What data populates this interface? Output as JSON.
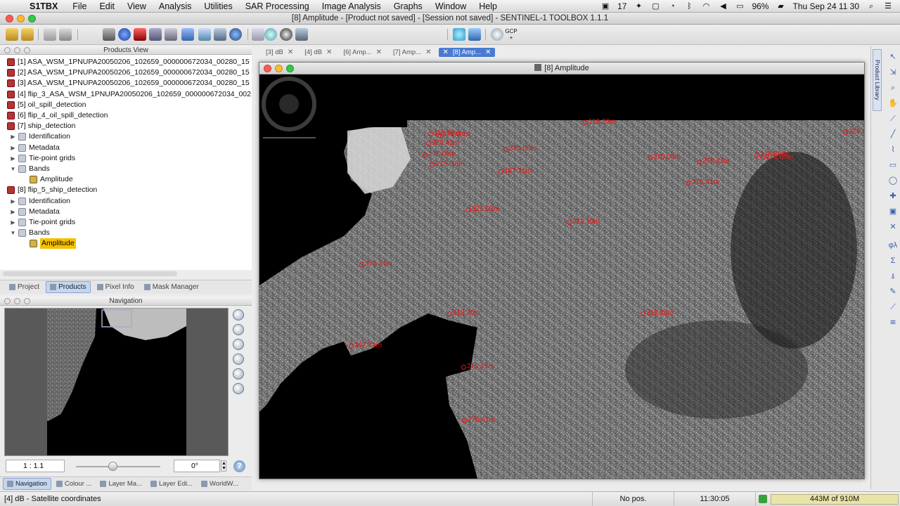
{
  "menubar": {
    "app": "S1TBX",
    "items": [
      "File",
      "Edit",
      "View",
      "Analysis",
      "Utilities",
      "SAR Processing",
      "Image Analysis",
      "Graphs",
      "Window",
      "Help"
    ],
    "status": {
      "cal": "17",
      "battery": "96%",
      "clock": "Thu Sep 24  11 30"
    }
  },
  "window": {
    "title": "[8] Amplitude - [Product not saved] - [Session not saved] - SENTINEL-1 TOOLBOX 1.1.1"
  },
  "products_view": {
    "title": "Products View",
    "items": [
      {
        "label": "[1] ASA_WSM_1PNUPA20050206_102659_000000672034_00280_15",
        "type": "prod",
        "indent": 0
      },
      {
        "label": "[2] ASA_WSM_1PNUPA20050206_102659_000000672034_00280_15",
        "type": "prod",
        "indent": 0
      },
      {
        "label": "[3] ASA_WSM_1PNUPA20050206_102659_000000672034_00280_15",
        "type": "prod",
        "indent": 0
      },
      {
        "label": "[4] flip_3_ASA_WSM_1PNUPA20050206_102659_000000672034_002",
        "type": "prod",
        "indent": 0
      },
      {
        "label": "[5] oil_spill_detection",
        "type": "prod",
        "indent": 0
      },
      {
        "label": "[6] flip_4_oil_spill_detection",
        "type": "prod",
        "indent": 0
      },
      {
        "label": "[7] ship_detection",
        "type": "prod",
        "indent": 0
      },
      {
        "label": "Identification",
        "type": "fold",
        "indent": 1,
        "arrow": "▶"
      },
      {
        "label": "Metadata",
        "type": "fold",
        "indent": 1,
        "arrow": "▶"
      },
      {
        "label": "Tie-point grids",
        "type": "fold",
        "indent": 1,
        "arrow": "▶"
      },
      {
        "label": "Bands",
        "type": "fold",
        "indent": 1,
        "arrow": "▼"
      },
      {
        "label": "Amplitude",
        "type": "band",
        "indent": 2
      },
      {
        "label": "[8] flip_5_ship_detection",
        "type": "prod",
        "indent": 0
      },
      {
        "label": "Identification",
        "type": "fold",
        "indent": 1,
        "arrow": "▶"
      },
      {
        "label": "Metadata",
        "type": "fold",
        "indent": 1,
        "arrow": "▶"
      },
      {
        "label": "Tie-point grids",
        "type": "fold",
        "indent": 1,
        "arrow": "▶"
      },
      {
        "label": "Bands",
        "type": "fold",
        "indent": 1,
        "arrow": "▼"
      },
      {
        "label": "Amplitude",
        "type": "band",
        "indent": 2,
        "selected": true
      }
    ]
  },
  "left_tabs": [
    "Project",
    "Products",
    "Pixel Info",
    "Mask Manager"
  ],
  "navigation": {
    "title": "Navigation",
    "scale": "1 : 1.1",
    "rotation": "0°",
    "help": "?"
  },
  "bottom_tabs": [
    "Navigation",
    "Colour ...",
    "Layer Ma...",
    "Layer Edi...",
    "WorldW..."
  ],
  "doc_tabs": [
    "[3] dB",
    "[4] dB",
    "[6] Amp...",
    "[7] Amp...",
    "[8] Amp..."
  ],
  "image_window": {
    "title": "[8] Amplitude"
  },
  "detections": [
    {
      "label": "118.20m"
    },
    {
      "label": "275.00m"
    },
    {
      "label": "375.00m"
    },
    {
      "label": "375.00m"
    },
    {
      "label": "270.42m"
    },
    {
      "label": "318.20m"
    },
    {
      "label": "167.71m"
    },
    {
      "label": "275.41m"
    },
    {
      "label": "221.00m"
    },
    {
      "label": "212.15m"
    },
    {
      "label": "375.41m"
    },
    {
      "label": "318.20m"
    },
    {
      "label": "318.20m"
    },
    {
      "label": "167.71m"
    },
    {
      "label": "212.15m"
    },
    {
      "label": "270.41m"
    },
    {
      "label": "375.00m"
    },
    {
      "label": "118.20m"
    },
    {
      "label": "370.41m"
    },
    {
      "label": "275.00m"
    },
    {
      "label": "275.00m"
    },
    {
      "label": "320.41m"
    }
  ],
  "right_palette": {
    "library": "Product Library"
  },
  "status": {
    "left": "[4] dB - Satellite coordinates",
    "pos": "No pos.",
    "time": "11:30:05",
    "memory": "443M of 910M"
  },
  "colors": {
    "selection": "#f7c100",
    "detection": "#e11",
    "accent": "#4a7bd1"
  }
}
